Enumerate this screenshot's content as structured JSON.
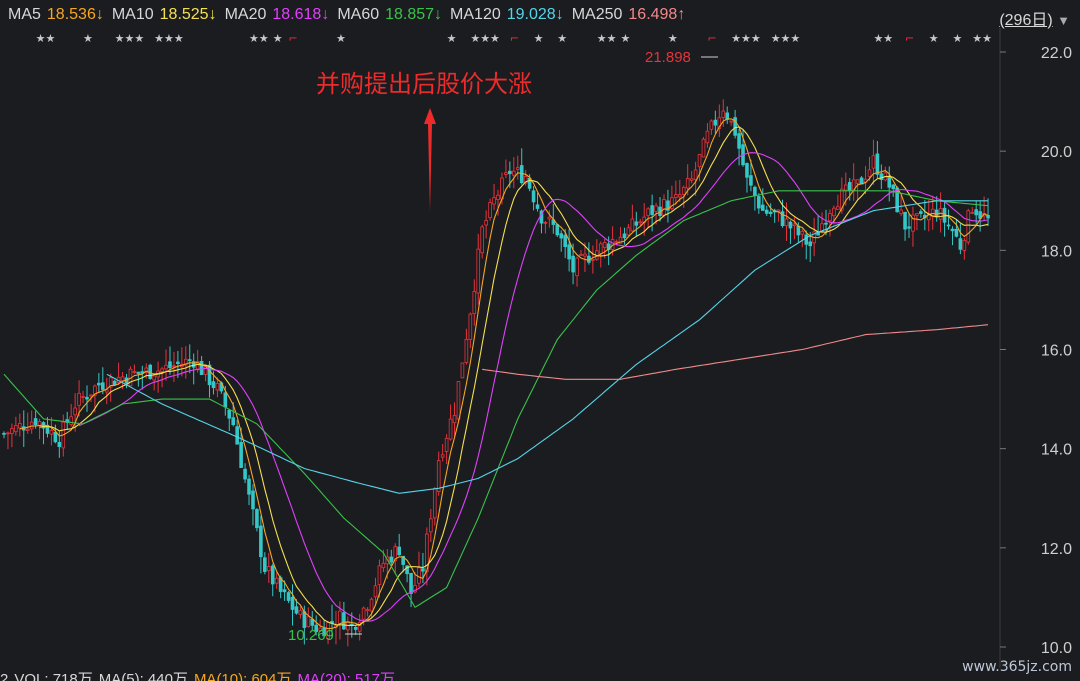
{
  "header": {
    "ma_items": [
      {
        "name": "MA5",
        "value": "18.536",
        "arrow": "↓",
        "color": "#f5a623"
      },
      {
        "name": "MA10",
        "value": "18.525",
        "arrow": "↓",
        "color": "#f4e04d"
      },
      {
        "name": "MA20",
        "value": "18.618",
        "arrow": "↓",
        "color": "#e040fb"
      },
      {
        "name": "MA60",
        "value": "18.857",
        "arrow": "↓",
        "color": "#39c24a"
      },
      {
        "name": "MA120",
        "value": "19.028",
        "arrow": "↓",
        "color": "#56d4e8"
      },
      {
        "name": "MA250",
        "value": "16.498",
        "arrow": "↑",
        "color": "#f08a8a"
      }
    ],
    "period_label": "(296日)",
    "period_icon": "triangle-down-icon"
  },
  "footer": {
    "items": [
      {
        "text": "2",
        "color": "#d8d8d8"
      },
      {
        "text": "VOL: 718万",
        "color": "#d8d8d8"
      },
      {
        "text": "MA(5): 440万",
        "color": "#d8d8d8"
      },
      {
        "text": "MA(10): 604万",
        "color": "#f5a623"
      },
      {
        "text": "MA(20): 517万",
        "color": "#e040fb"
      }
    ]
  },
  "watermark": "www.365jz.com",
  "chart_data": {
    "type": "candlestick",
    "annotation": "并购提出后股价大涨",
    "high_label": "21.898",
    "low_label": "10.269",
    "ylim": [
      10.0,
      22.0
    ],
    "yticks": [
      "22.0",
      "20.0",
      "18.0",
      "16.0",
      "14.0",
      "12.0",
      "10.0"
    ],
    "colors": {
      "up": "#e8333c",
      "down": "#35c7c7",
      "annotation": "#ee2b2b",
      "low_label": "#39c24a"
    },
    "ma_series": [
      {
        "name": "MA5",
        "color": "#f5a623"
      },
      {
        "name": "MA10",
        "color": "#f4e04d"
      },
      {
        "name": "MA20",
        "color": "#e040fb"
      },
      {
        "name": "MA60",
        "color": "#39c24a"
      },
      {
        "name": "MA120",
        "color": "#56d4e8"
      },
      {
        "name": "MA250",
        "color": "#f08a8a"
      }
    ],
    "anchors": [
      [
        0,
        14.3
      ],
      [
        8,
        14.6
      ],
      [
        14,
        14.2
      ],
      [
        18,
        14.9
      ],
      [
        24,
        15.3
      ],
      [
        32,
        15.5
      ],
      [
        40,
        15.6
      ],
      [
        48,
        15.8
      ],
      [
        54,
        15.2
      ],
      [
        58,
        14.5
      ],
      [
        62,
        13.0
      ],
      [
        66,
        11.6
      ],
      [
        70,
        11.1
      ],
      [
        75,
        10.6
      ],
      [
        80,
        10.35
      ],
      [
        85,
        10.6
      ],
      [
        88,
        10.4
      ],
      [
        92,
        10.9
      ],
      [
        96,
        11.7
      ],
      [
        100,
        12.0
      ],
      [
        103,
        11.1
      ],
      [
        106,
        11.6
      ],
      [
        110,
        13.8
      ],
      [
        114,
        14.8
      ],
      [
        118,
        16.8
      ],
      [
        121,
        18.4
      ],
      [
        124,
        19.0
      ],
      [
        128,
        19.6
      ],
      [
        132,
        19.5
      ],
      [
        136,
        18.7
      ],
      [
        140,
        18.4
      ],
      [
        144,
        17.6
      ],
      [
        148,
        17.9
      ],
      [
        152,
        18.1
      ],
      [
        158,
        18.4
      ],
      [
        164,
        18.8
      ],
      [
        170,
        19.0
      ],
      [
        174,
        19.4
      ],
      [
        178,
        20.3
      ],
      [
        182,
        20.9
      ],
      [
        185,
        20.4
      ],
      [
        188,
        19.4
      ],
      [
        192,
        18.8
      ],
      [
        196,
        18.7
      ],
      [
        200,
        18.4
      ],
      [
        204,
        18.1
      ],
      [
        210,
        19.0
      ],
      [
        216,
        19.3
      ],
      [
        220,
        19.8
      ],
      [
        224,
        19.3
      ],
      [
        228,
        18.5
      ],
      [
        232,
        18.6
      ],
      [
        236,
        18.8
      ],
      [
        240,
        18.4
      ],
      [
        242,
        18.1
      ],
      [
        245,
        18.9
      ],
      [
        249,
        18.6
      ]
    ],
    "ma_extra": {
      "ma60": [
        [
          0,
          15.5
        ],
        [
          10,
          14.6
        ],
        [
          20,
          14.5
        ],
        [
          30,
          14.9
        ],
        [
          40,
          15.0
        ],
        [
          52,
          15.0
        ],
        [
          64,
          14.5
        ],
        [
          76,
          13.5
        ],
        [
          86,
          12.6
        ],
        [
          96,
          11.9
        ],
        [
          104,
          10.8
        ],
        [
          112,
          11.2
        ],
        [
          120,
          12.6
        ],
        [
          130,
          14.6
        ],
        [
          140,
          16.2
        ],
        [
          150,
          17.2
        ],
        [
          160,
          17.9
        ],
        [
          172,
          18.6
        ],
        [
          184,
          19.0
        ],
        [
          196,
          19.2
        ],
        [
          210,
          19.2
        ],
        [
          224,
          19.2
        ],
        [
          236,
          19.0
        ],
        [
          249,
          18.9
        ]
      ],
      "ma120": [
        [
          26,
          15.5
        ],
        [
          40,
          14.9
        ],
        [
          60,
          14.2
        ],
        [
          76,
          13.6
        ],
        [
          90,
          13.3
        ],
        [
          100,
          13.1
        ],
        [
          110,
          13.2
        ],
        [
          120,
          13.4
        ],
        [
          130,
          13.8
        ],
        [
          144,
          14.6
        ],
        [
          160,
          15.7
        ],
        [
          176,
          16.6
        ],
        [
          190,
          17.6
        ],
        [
          204,
          18.3
        ],
        [
          220,
          18.8
        ],
        [
          236,
          19.0
        ],
        [
          249,
          19.0
        ]
      ],
      "ma250": [
        [
          121,
          15.6
        ],
        [
          130,
          15.5
        ],
        [
          142,
          15.4
        ],
        [
          156,
          15.4
        ],
        [
          170,
          15.6
        ],
        [
          186,
          15.8
        ],
        [
          202,
          16.0
        ],
        [
          218,
          16.3
        ],
        [
          236,
          16.4
        ],
        [
          249,
          16.5
        ]
      ]
    },
    "signal_row": [
      {
        "text": "★★",
        "pos": 8
      },
      {
        "text": "★",
        "pos": 20
      },
      {
        "text": "★★★",
        "pos": 28
      },
      {
        "text": "★★★",
        "pos": 38
      },
      {
        "text": "★★",
        "pos": 62
      },
      {
        "text": "★",
        "pos": 68
      },
      {
        "text": "⌐",
        "pos": 72
      },
      {
        "text": "★",
        "pos": 84
      },
      {
        "text": "★",
        "pos": 112
      },
      {
        "text": "★★★",
        "pos": 118
      },
      {
        "text": "⌐",
        "pos": 128
      },
      {
        "text": "★",
        "pos": 134
      },
      {
        "text": "★",
        "pos": 140
      },
      {
        "text": "★★",
        "pos": 150
      },
      {
        "text": "★",
        "pos": 156
      },
      {
        "text": "★",
        "pos": 168
      },
      {
        "text": "⌐",
        "pos": 178
      },
      {
        "text": "★★★",
        "pos": 184
      },
      {
        "text": "★★★",
        "pos": 194
      },
      {
        "text": "★★",
        "pos": 220
      },
      {
        "text": "⌐",
        "pos": 228
      },
      {
        "text": "★",
        "pos": 234
      },
      {
        "text": "★",
        "pos": 240
      },
      {
        "text": "★★",
        "pos": 245
      }
    ]
  }
}
